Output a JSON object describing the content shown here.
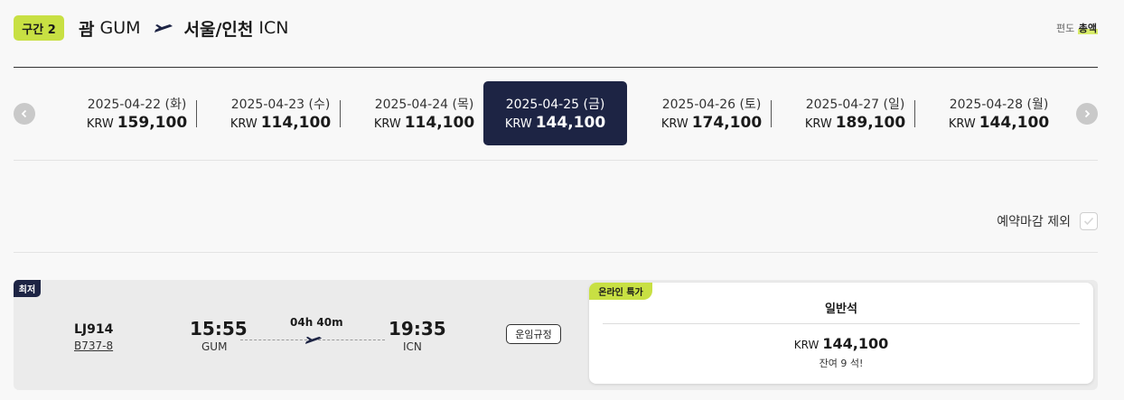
{
  "header": {
    "segment_label": "구간 2",
    "origin_city": "괌",
    "origin_code": "GUM",
    "dest_city": "서울/인천",
    "dest_code": "ICN",
    "fare_one_way": "편도",
    "fare_total": "총액"
  },
  "dates": [
    {
      "date": "2025-04-22 (화)",
      "currency": "KRW",
      "price": "159,100",
      "selected": false
    },
    {
      "date": "2025-04-23 (수)",
      "currency": "KRW",
      "price": "114,100",
      "selected": false
    },
    {
      "date": "2025-04-24 (목)",
      "currency": "KRW",
      "price": "114,100",
      "selected": false
    },
    {
      "date": "2025-04-25 (금)",
      "currency": "KRW",
      "price": "144,100",
      "selected": true
    },
    {
      "date": "2025-04-26 (토)",
      "currency": "KRW",
      "price": "174,100",
      "selected": false
    },
    {
      "date": "2025-04-27 (일)",
      "currency": "KRW",
      "price": "189,100",
      "selected": false
    },
    {
      "date": "2025-04-28 (월)",
      "currency": "KRW",
      "price": "144,100",
      "selected": false
    }
  ],
  "filter": {
    "exclude_closed_label": "예약마감 제외",
    "checked": false
  },
  "flight": {
    "badge": "최저",
    "number": "LJ914",
    "aircraft": "B737-8",
    "dep_time": "15:55",
    "dep_code": "GUM",
    "duration": "04h 40m",
    "arr_time": "19:35",
    "arr_code": "ICN",
    "rules_label": "운임규정",
    "fare": {
      "promo": "온라인 특가",
      "cabin": "일반석",
      "currency": "KRW",
      "price": "144,100",
      "seats_left": "잔여 9 석!"
    }
  },
  "colors": {
    "accent_lime": "#c8e043",
    "navy": "#1d2444"
  }
}
